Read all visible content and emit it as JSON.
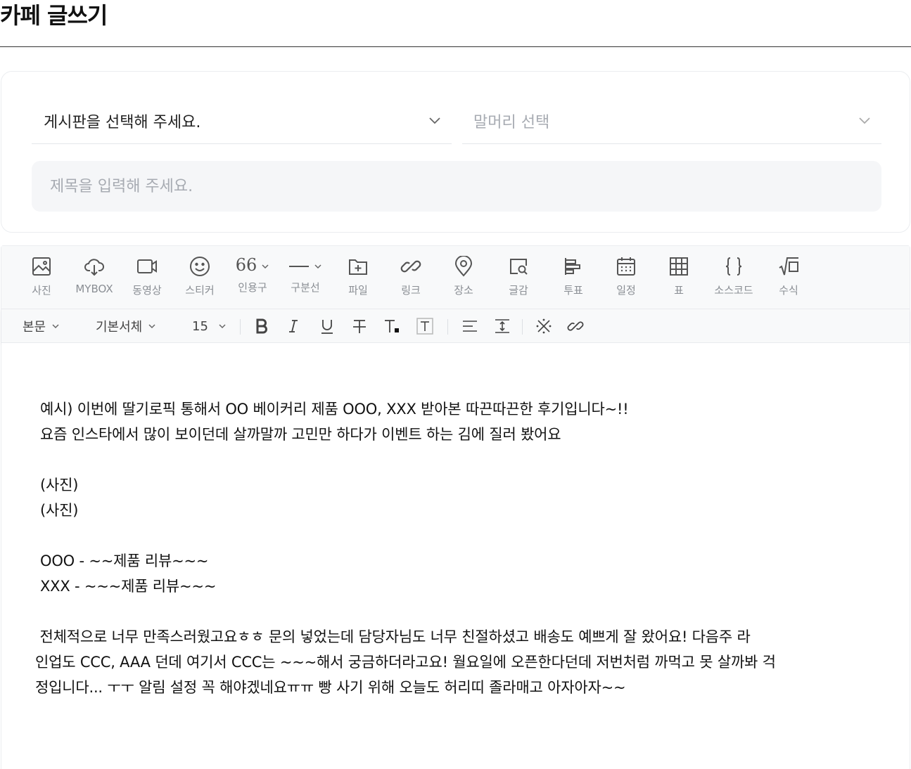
{
  "header": {
    "title": "카페 글쓰기"
  },
  "form": {
    "board_select": "게시판을 선택해 주세요.",
    "prefix_select": "말머리 선택",
    "title_placeholder": "제목을 입력해 주세요."
  },
  "toolbar": {
    "insert": [
      {
        "label": "사진",
        "icon": "image-icon"
      },
      {
        "label": "MYBOX",
        "icon": "cloud-download-icon"
      },
      {
        "label": "동영상",
        "icon": "video-icon"
      },
      {
        "label": "스티커",
        "icon": "smiley-icon"
      },
      {
        "label": "인용구",
        "icon": "quote-icon"
      },
      {
        "label": "구분선",
        "icon": "divider-line-icon"
      },
      {
        "label": "파일",
        "icon": "folder-plus-icon"
      },
      {
        "label": "링크",
        "icon": "link-icon"
      },
      {
        "label": "장소",
        "icon": "map-pin-icon"
      },
      {
        "label": "글감",
        "icon": "search-content-icon"
      },
      {
        "label": "투표",
        "icon": "poll-icon"
      },
      {
        "label": "일정",
        "icon": "calendar-icon"
      },
      {
        "label": "표",
        "icon": "table-icon"
      },
      {
        "label": "소스코드",
        "icon": "code-braces-icon"
      },
      {
        "label": "수식",
        "icon": "formula-icon"
      }
    ],
    "format": {
      "paragraph_style": "본문",
      "font_family": "기본서체",
      "font_size": "15",
      "quote_glyph": "66"
    }
  },
  "editor": {
    "lines": [
      "예시) 이번에 딸기로픽 통해서 OO 베이커리 제품 OOO, XXX 받아본 따끈따끈한 후기입니다~!!",
      "요즘 인스타에서 많이 보이던데 살까말까 고민만 하다가 이벤트 하는 김에 질러 봤어요",
      "(사진)",
      "(사진)",
      "OOO - ~~제품 리뷰~~~",
      "XXX - ~~~제품 리뷰~~~",
      " 전체적으로 너무 만족스러웠고요ㅎㅎ 문의 넣었는데 담당자님도 너무 친절하셨고 배송도 예쁘게 잘 왔어요! 다음주 라",
      "인업도 CCC, AAA 던데 여기서 CCC는 ~~~해서 궁금하더라고요! 월요일에 오픈한다던데 저번처럼 까먹고 못 살까봐 걱",
      "정입니다... ㅜㅜ 알림 설정 꼭 해야겠네요ㅠㅠ 빵 사기 위해 오늘도 허리띠 졸라매고 아자아자~~"
    ]
  }
}
